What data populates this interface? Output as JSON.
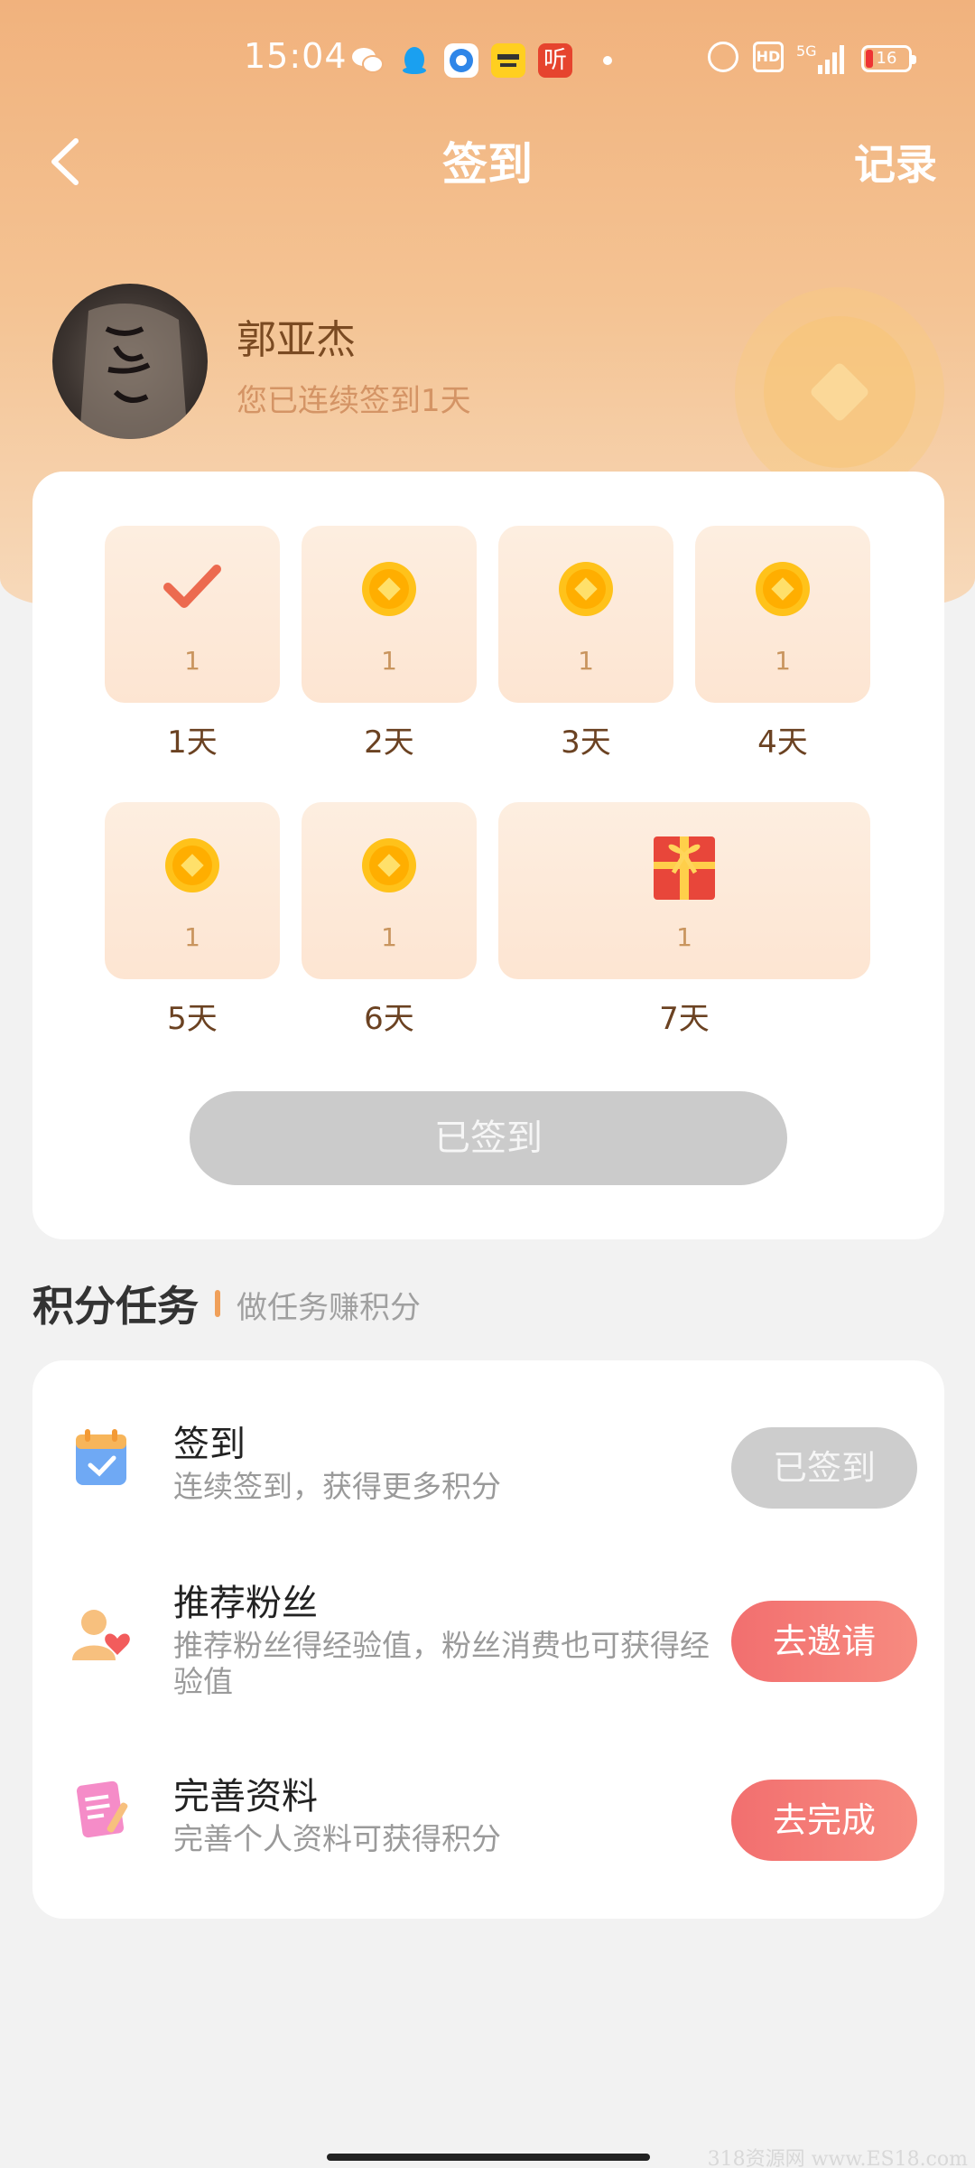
{
  "status_bar": {
    "time": "15:04",
    "app_ting": "听",
    "hd": "HD",
    "network": "5G",
    "battery": "16"
  },
  "nav": {
    "title": "签到",
    "record": "记录"
  },
  "profile": {
    "name": "郭亚杰",
    "streak_text": "您已连续签到1天"
  },
  "sign_in": {
    "days": [
      {
        "label": "1天",
        "reward": "1",
        "icon": "check-icon",
        "checked": true
      },
      {
        "label": "2天",
        "reward": "1",
        "icon": "coin-icon",
        "checked": false
      },
      {
        "label": "3天",
        "reward": "1",
        "icon": "coin-icon",
        "checked": false
      },
      {
        "label": "4天",
        "reward": "1",
        "icon": "coin-icon",
        "checked": false
      },
      {
        "label": "5天",
        "reward": "1",
        "icon": "coin-icon",
        "checked": false
      },
      {
        "label": "6天",
        "reward": "1",
        "icon": "coin-icon",
        "checked": false
      },
      {
        "label": "7天",
        "reward": "1",
        "icon": "gift-icon",
        "checked": false
      }
    ],
    "button_label": "已签到"
  },
  "tasks": {
    "title": "积分任务",
    "subtitle": "做任务赚积分",
    "items": [
      {
        "title": "签到",
        "desc": "连续签到，获得更多积分",
        "button": "已签到",
        "icon": "calendar-icon",
        "done": true
      },
      {
        "title": "推荐粉丝",
        "desc": "推荐粉丝得经验值，粉丝消费也可获得经验值",
        "button": "去邀请",
        "icon": "user-heart-icon",
        "done": false
      },
      {
        "title": "完善资料",
        "desc": "完善个人资料可获得积分",
        "button": "去完成",
        "icon": "profile-doc-icon",
        "done": false
      }
    ]
  },
  "colors": {
    "header_orange": "#f1b27d",
    "accent_red": "#f26f6f",
    "disabled_gray": "#cbcbcb",
    "day_box": "#fde8d6"
  },
  "watermark": "318资源网 www.ES18.com"
}
